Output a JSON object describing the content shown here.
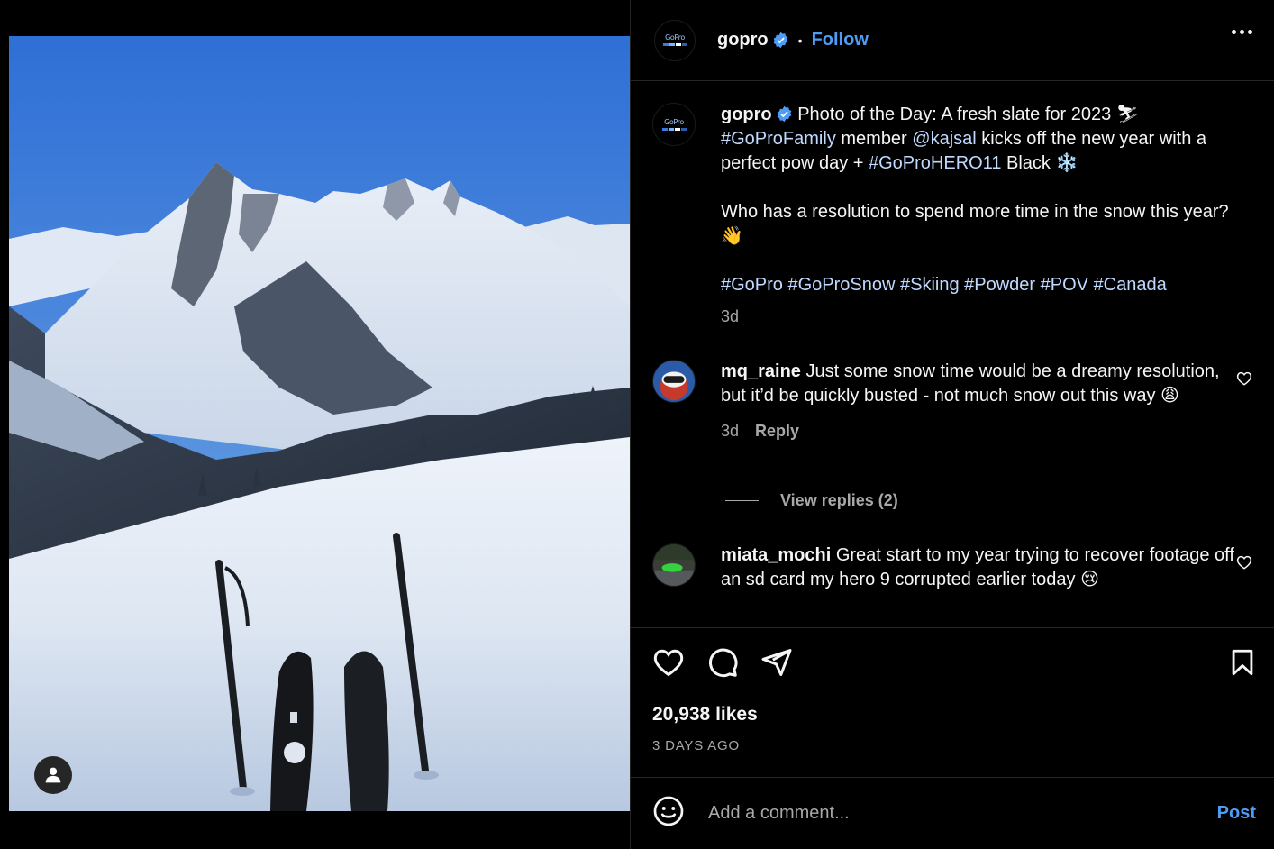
{
  "post": {
    "username": "gopro",
    "follow_label": "Follow",
    "separator": "•",
    "avatar_logo_text": "GoPro"
  },
  "caption": {
    "username": "gopro",
    "line1": "Photo of the Day: A fresh slate for 2023 ⛷",
    "hashtag_family": "#GoProFamily",
    "member_text": " member ",
    "mention": "@kajsal",
    "line2_rest": " kicks off the new year with a perfect pow day + ",
    "hashtag_hero": "#GoProHERO11",
    "line3_rest": " Black ❄️",
    "paragraph2": "Who has a resolution to spend more time in the snow this year? 👋",
    "hashtags": "#GoPro #GoProSnow #Skiing #Powder #POV #Canada",
    "time": "3d"
  },
  "comments": [
    {
      "username": "mq_raine",
      "text": "Just some snow time would be a dreamy resolution, but it’d be quickly busted - not much snow out this way 😩",
      "time": "3d",
      "reply_label": "Reply",
      "view_replies": "View replies (2)"
    },
    {
      "username": "miata_mochi",
      "text": "Great start to my year trying to recover footage off an sd card my hero 9 corrupted earlier today 😢"
    }
  ],
  "stats": {
    "likes": "20,938 likes",
    "posted": "3 DAYS AGO"
  },
  "add_comment": {
    "placeholder": "Add a comment...",
    "post_label": "Post"
  },
  "colors": {
    "accent": "#4f9cf7",
    "background": "#000000",
    "muted_text": "#a8a8a8",
    "border": "#262626"
  },
  "icons": [
    "verified-badge-icon",
    "more-options-icon",
    "heart-icon",
    "comment-icon",
    "share-icon",
    "bookmark-icon",
    "emoji-icon",
    "user-tag-icon"
  ]
}
